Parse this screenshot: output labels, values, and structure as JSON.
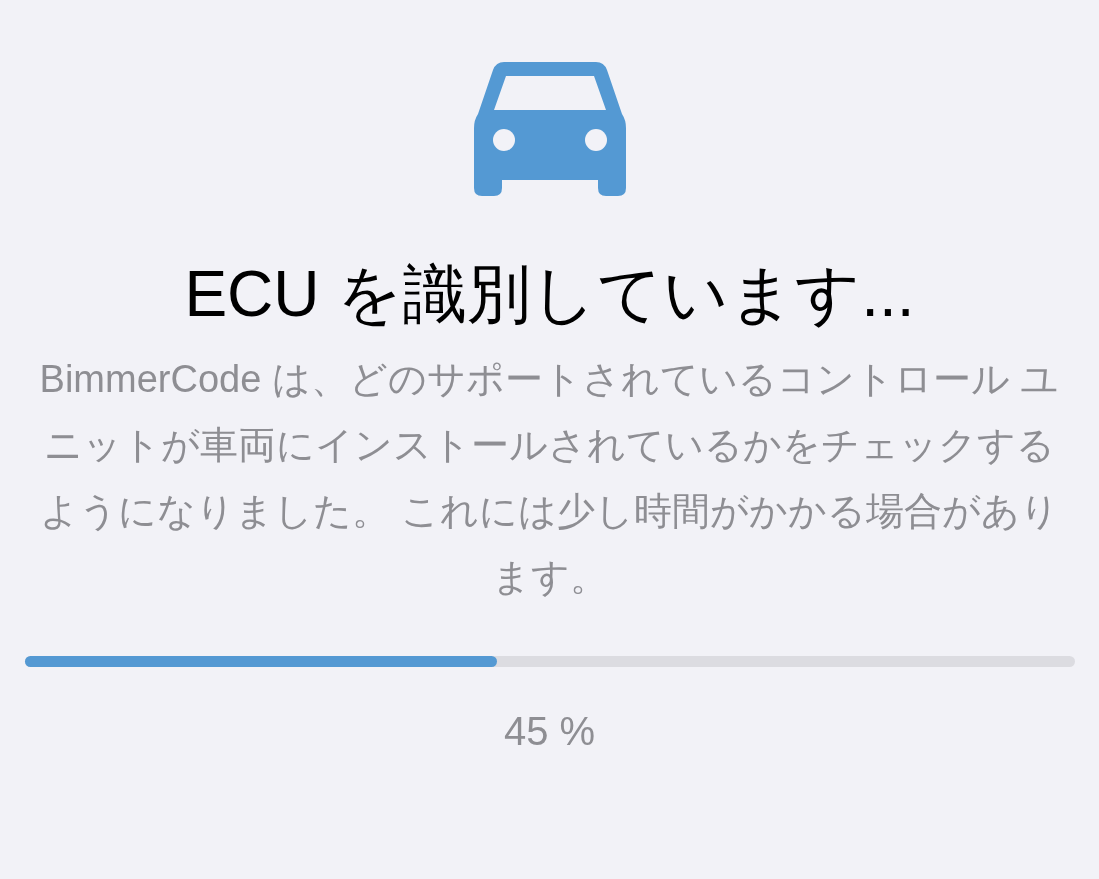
{
  "title": "ECU を識別しています...",
  "description": "BimmerCode は、どのサポートされているコントロール ユニットが車両にインストールされているかをチェックするようになりました。 これには少し時間がかかる場合があります。",
  "progress": {
    "level": 0.45,
    "reading": "45 %"
  }
}
